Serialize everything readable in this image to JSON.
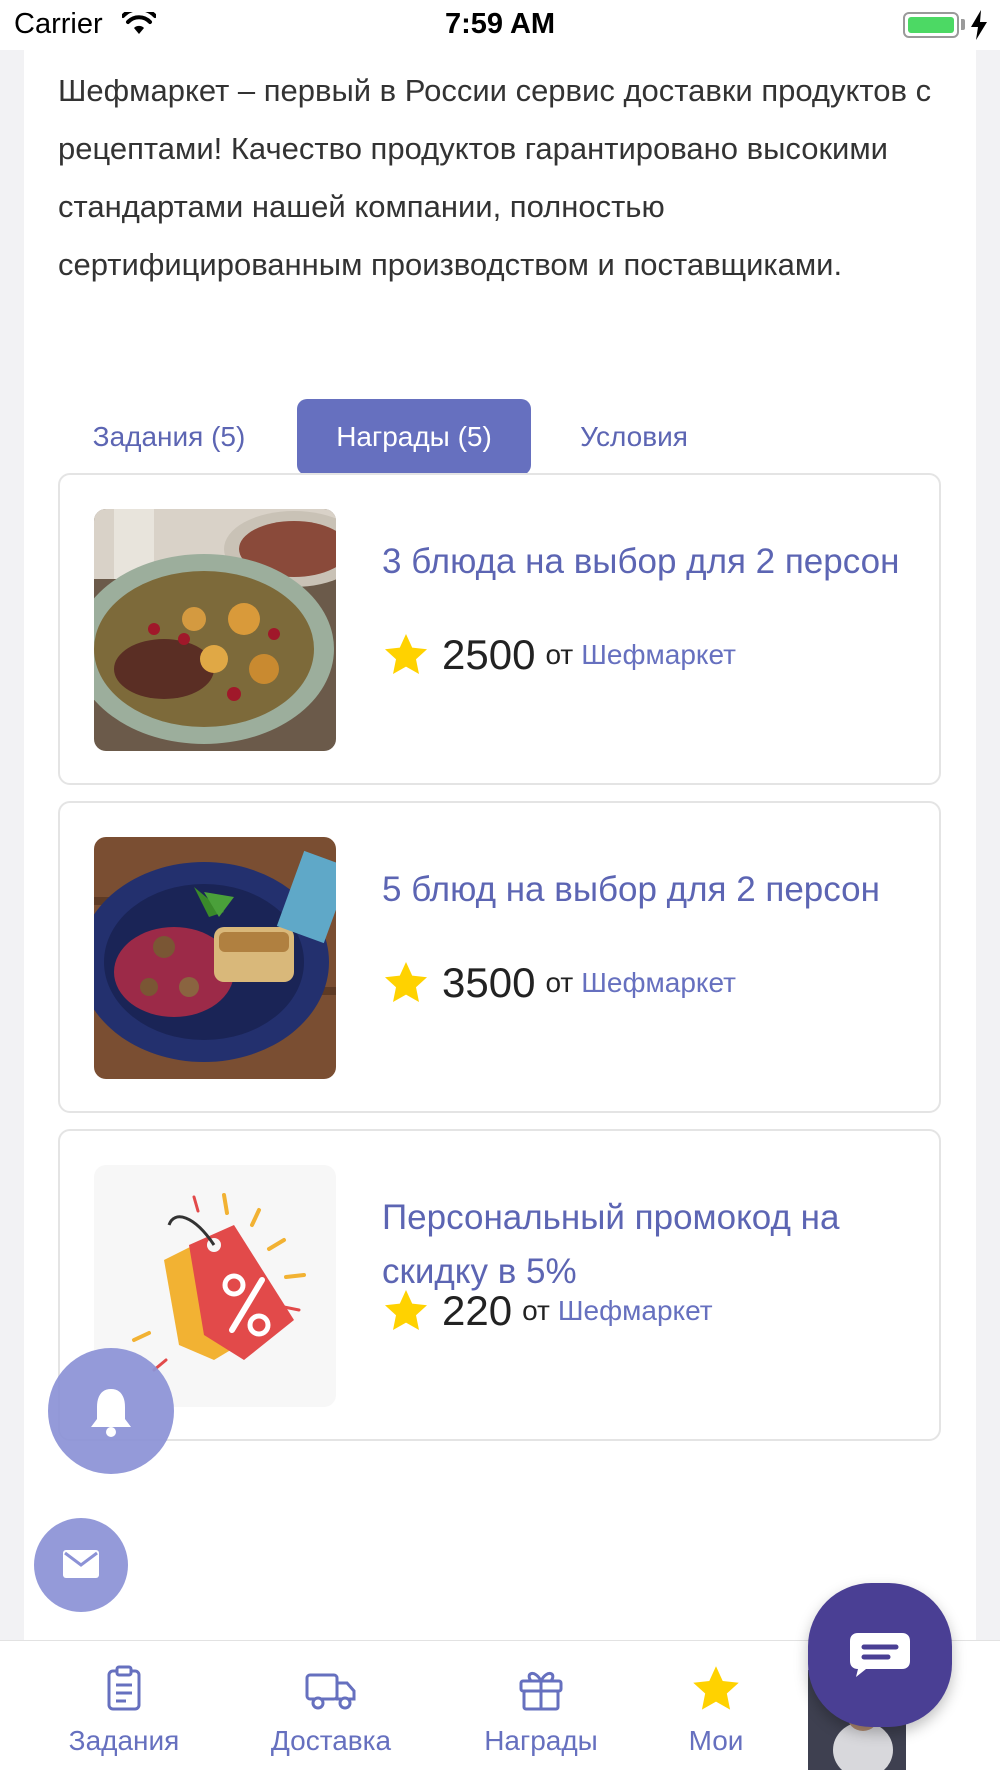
{
  "status_bar": {
    "carrier": "Carrier",
    "time": "7:59 AM"
  },
  "intro_text": "Шефмаркет – первый в России сервис доставки продуктов с рецептами! Качество продуктов гарантировано высокими стандартами нашей компании, полностью сертифицированным производством и поставщиками.",
  "tabs": [
    {
      "label": "Задания (5)",
      "active": false
    },
    {
      "label": "Награды (5)",
      "active": true
    },
    {
      "label": "Условия",
      "active": false
    }
  ],
  "rewards": [
    {
      "title": "3 блюда на выбор для 2 персон",
      "points": "2500",
      "from": "от",
      "partner": "Шефмаркет",
      "image": "steak-with-potatoes"
    },
    {
      "title": "5 блюд на выбор для 2 персон",
      "points": "3500",
      "from": "от",
      "partner": "Шефмаркет",
      "image": "fish-with-risotto"
    },
    {
      "title": "Персональный промокод на скидку в 5%",
      "points": "220",
      "from": "от",
      "partner": "Шефмаркет",
      "image": "discount-tag"
    }
  ],
  "tabbar": [
    {
      "label": "Задания",
      "icon": "clipboard-icon"
    },
    {
      "label": "Доставка",
      "icon": "truck-icon"
    },
    {
      "label": "Награды",
      "icon": "gift-icon"
    },
    {
      "label": "Мои",
      "icon": "star-icon"
    }
  ],
  "colors": {
    "accent": "#6670bf",
    "star": "#ffd200",
    "chat": "#4a3f94",
    "fab": "#8c92d6"
  }
}
